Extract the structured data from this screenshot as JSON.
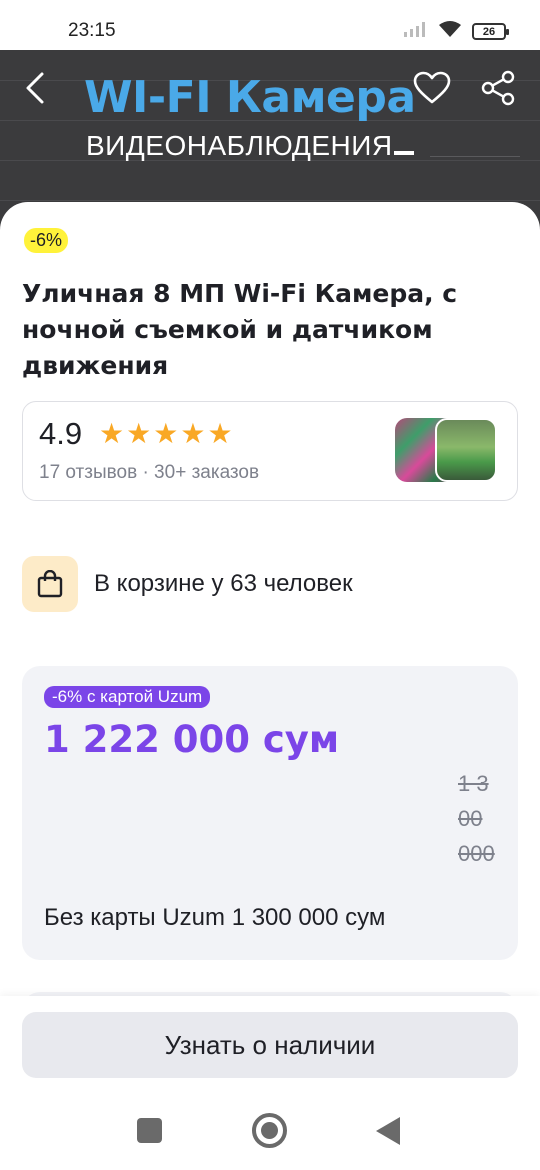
{
  "status_bar": {
    "time": "23:15",
    "battery": "26",
    "icons": [
      "signal-icon",
      "wifi-icon",
      "battery-icon"
    ]
  },
  "banner": {
    "title": "WI-FI Камера",
    "subtitle": "ВИДЕОНАБЛЮДЕНИЯ",
    "title_color": "#4aa9e8",
    "background": "#3b3b3d",
    "icons": [
      "back-arrow-icon",
      "heart-icon",
      "share-icon"
    ]
  },
  "product": {
    "discount": "-6%",
    "title": "Уличная 8 МП Wi-Fi Камера, с ночной съемкой и датчиком движения",
    "rating": "4.9",
    "stars": 5,
    "reviews_meta": "17 отзывов · 30+ заказов",
    "cart_text": "В корзине у 63 человек"
  },
  "price": {
    "card_badge": "-6% с картой Uzum",
    "card_price": "1 222 000 сум",
    "old_price": "1 300 000",
    "no_card_text": "Без карты Uzum 1 300 000 сум",
    "accent": "#7b45e8"
  },
  "bottom": {
    "action_label": "Узнать о наличии"
  },
  "system_nav": {
    "icons": [
      "recents-icon",
      "home-icon",
      "back-icon"
    ]
  }
}
